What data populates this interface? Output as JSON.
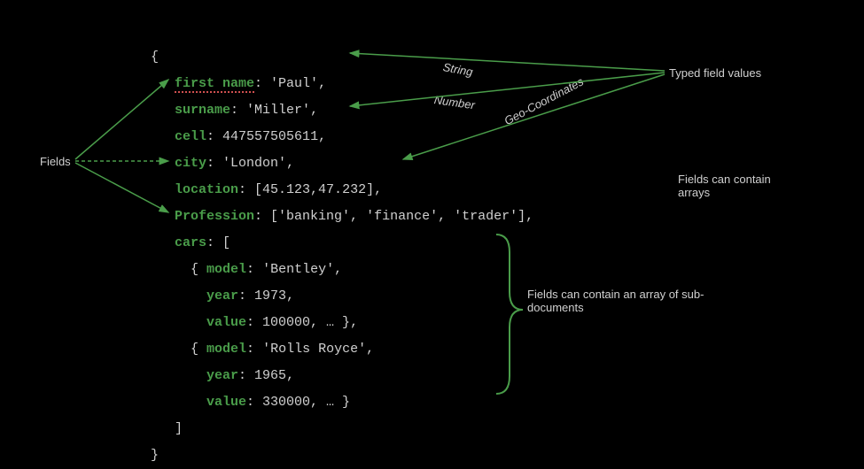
{
  "labels": {
    "fields": "Fields",
    "typed_values": "Typed field values",
    "string": "String",
    "number": "Number",
    "geo": "Geo-Coordinates",
    "arrays_note": "Fields can contain arrays",
    "subdoc_note": "Fields can contain an array of sub-documents"
  },
  "doc": {
    "open_brace": "{",
    "first_name_key": "first name",
    "first_name_sep": ": ",
    "first_name_val": "'Paul'",
    "surname_key": "surname",
    "surname_sep": ": ",
    "surname_val": "'Miller'",
    "cell_key": "cell",
    "cell_sep": ": ",
    "cell_val": "447557505611",
    "city_key": "city",
    "city_sep": ": ",
    "city_val": "'London'",
    "location_key": "location",
    "location_sep": ": ",
    "location_val": "[45.123,47.232]",
    "profession_key": "Profession",
    "profession_sep": ": ",
    "profession_val": "['banking', 'finance', 'trader']",
    "cars_key": "cars",
    "cars_sep": ": [",
    "car1_open": "  { ",
    "car1_model_key": "model",
    "car1_model_sep": ": ",
    "car1_model_val": "'Bentley'",
    "car1_year_key": "year",
    "car1_year_sep": ": ",
    "car1_year_val": "1973",
    "car1_value_key": "value",
    "car1_value_sep": ": ",
    "car1_value_val": "100000, … }",
    "car2_open": "  { ",
    "car2_model_key": "model",
    "car2_model_sep": ": ",
    "car2_model_val": "'Rolls Royce'",
    "car2_year_key": "year",
    "car2_year_sep": ": ",
    "car2_year_val": "1965",
    "car2_value_key": "value",
    "car2_value_sep": ": ",
    "car2_value_val": "330000, … }",
    "close_bracket": "]",
    "close_brace": "}",
    "comma": ","
  }
}
